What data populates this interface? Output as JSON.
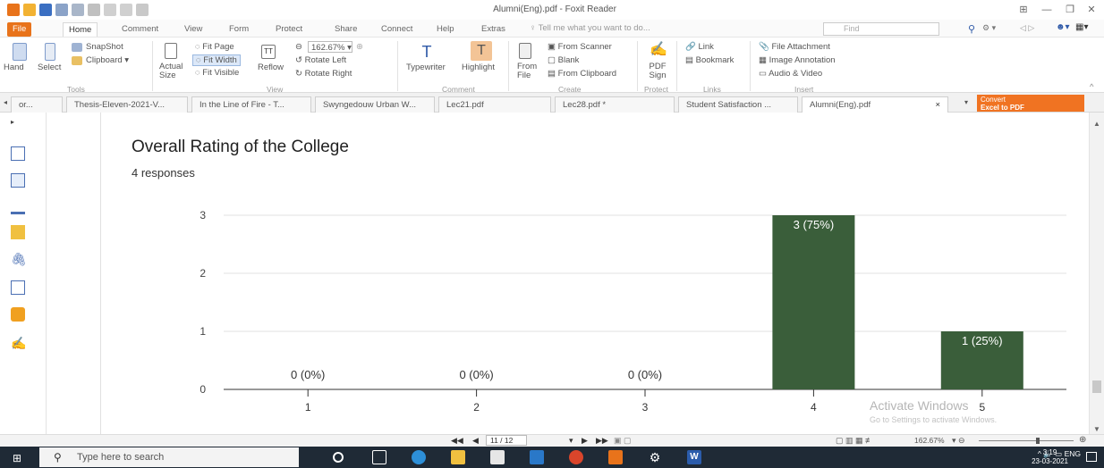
{
  "window": {
    "title": "Alumni(Eng).pdf - Foxit Reader"
  },
  "menu": {
    "tabs": [
      "File",
      "Home",
      "Comment",
      "View",
      "Form",
      "Protect",
      "Share",
      "Connect",
      "Help",
      "Extras"
    ],
    "tell_me": "Tell me what you want to do...",
    "find_placeholder": "Find"
  },
  "ribbon": {
    "tools": {
      "hand": "Hand",
      "select": "Select",
      "snapshot": "SnapShot",
      "clipboard": "Clipboard ▾",
      "label": "Tools"
    },
    "view": {
      "actual_size": "Actual Size",
      "fit_page": "Fit Page",
      "fit_width": "Fit Width",
      "fit_visible": "Fit Visible",
      "reflow": "Reflow",
      "zoom_value": "162.67%",
      "rotate_left": "Rotate Left",
      "rotate_right": "Rotate Right",
      "label": "View"
    },
    "comment": {
      "typewriter": "Typewriter",
      "highlight": "Highlight",
      "label": "Comment"
    },
    "create": {
      "from_file": "From File",
      "from_scanner": "From Scanner",
      "blank": "Blank",
      "from_clipboard": "From Clipboard",
      "label": "Create"
    },
    "protect": {
      "pdf_sign": "PDF Sign",
      "label": "Protect"
    },
    "links": {
      "link": "Link",
      "bookmark": "Bookmark",
      "label": "Links"
    },
    "insert": {
      "file_attachment": "File Attachment",
      "image_annotation": "Image Annotation",
      "audio_video": "Audio & Video",
      "label": "Insert"
    }
  },
  "doc_tabs": [
    "or...",
    "Thesis-Eleven-2021-V...",
    "In the Line of Fire - T...",
    "Swyngedouw Urban W...",
    "Lec21.pdf",
    "Lec28.pdf *",
    "Student Satisfaction ...",
    "Alumni(Eng).pdf"
  ],
  "convert_button": {
    "line1": "Convert",
    "line2": "Excel to PDF"
  },
  "chart_data": {
    "type": "bar",
    "title": "Overall Rating of the College",
    "subtitle": "4 responses",
    "categories": [
      "1",
      "2",
      "3",
      "4",
      "5"
    ],
    "values": [
      0,
      0,
      0,
      3,
      1
    ],
    "data_labels": [
      "0 (0%)",
      "0 (0%)",
      "0 (0%)",
      "3 (75%)",
      "1 (25%)"
    ],
    "yticks": [
      "0",
      "1",
      "2",
      "3"
    ],
    "ylim": [
      0,
      3
    ],
    "bar_color": "#3a5e3a",
    "grid": true
  },
  "watermark": {
    "line1": "Activate Windows",
    "line2": "Go to Settings to activate Windows."
  },
  "statusbar": {
    "page": "11 / 12",
    "zoom": "162.67%"
  },
  "taskbar": {
    "search_placeholder": "Type here to search",
    "language": "ENG",
    "time": "3:19",
    "date": "23-03-2021"
  }
}
